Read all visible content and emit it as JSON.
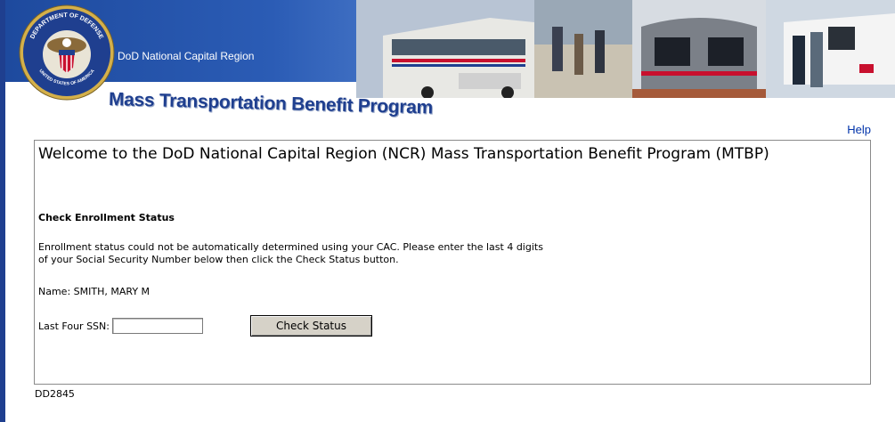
{
  "header": {
    "region": "DoD National Capital Region",
    "program_title": "Mass Transportation Benefit Program"
  },
  "seal": {
    "top_text": "DEPARTMENT OF DEFENSE",
    "bottom_text": "UNITED STATES OF AMERICA"
  },
  "nav": {
    "help": "Help"
  },
  "main": {
    "welcome": "Welcome to the DoD National Capital Region (NCR) Mass Transportation Benefit Program (MTBP)",
    "section_title": "Check Enrollment Status",
    "info_line1": "Enrollment status could not be automatically determined using your CAC. Please enter the last 4 digits",
    "info_line2": "of your Social Security Number below then click the Check Status button.",
    "name_label": "Name:",
    "name_value": "SMITH, MARY M",
    "ssn_label": "Last Four SSN:",
    "ssn_value": "",
    "button_label": "Check Status"
  },
  "footer": {
    "code": "DD2845"
  },
  "colors": {
    "banner_blue": "#1e4a9e",
    "title_blue": "#1f3f8f",
    "link_blue": "#0033aa",
    "button_face": "#d6d2c8"
  }
}
